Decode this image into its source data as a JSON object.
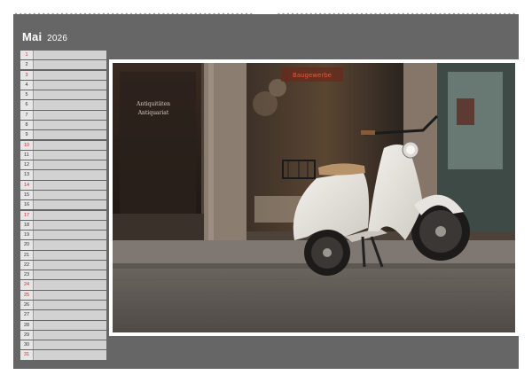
{
  "calendar": {
    "month": "Mai",
    "year": "2026",
    "days": [
      {
        "n": "1",
        "red": true
      },
      {
        "n": "2",
        "red": false
      },
      {
        "n": "3",
        "red": true
      },
      {
        "n": "4",
        "red": false
      },
      {
        "n": "5",
        "red": false
      },
      {
        "n": "6",
        "red": false
      },
      {
        "n": "7",
        "red": false
      },
      {
        "n": "8",
        "red": false
      },
      {
        "n": "9",
        "red": false
      },
      {
        "n": "10",
        "red": true
      },
      {
        "n": "11",
        "red": false
      },
      {
        "n": "12",
        "red": false
      },
      {
        "n": "13",
        "red": false
      },
      {
        "n": "14",
        "red": true
      },
      {
        "n": "15",
        "red": false
      },
      {
        "n": "16",
        "red": false
      },
      {
        "n": "17",
        "red": true
      },
      {
        "n": "18",
        "red": false
      },
      {
        "n": "19",
        "red": false
      },
      {
        "n": "20",
        "red": false
      },
      {
        "n": "21",
        "red": false
      },
      {
        "n": "22",
        "red": false
      },
      {
        "n": "23",
        "red": false
      },
      {
        "n": "24",
        "red": true
      },
      {
        "n": "25",
        "red": true
      },
      {
        "n": "26",
        "red": false
      },
      {
        "n": "27",
        "red": false
      },
      {
        "n": "28",
        "red": false
      },
      {
        "n": "29",
        "red": false
      },
      {
        "n": "30",
        "red": false
      },
      {
        "n": "31",
        "red": true
      }
    ]
  },
  "photo": {
    "subject": "white vintage scooter in front of shop windows on cobblestone street"
  },
  "colors": {
    "page_background": "#666666",
    "sunday_holiday": "#c4332b",
    "day_cell": "#d7d7d7"
  }
}
